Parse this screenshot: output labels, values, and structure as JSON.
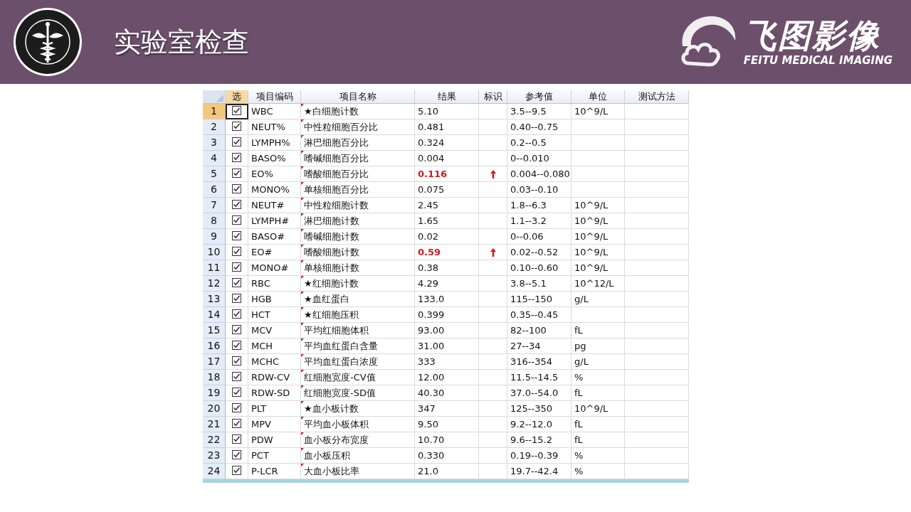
{
  "header": {
    "title": "实验室检查",
    "brand": {
      "name": "飞图影像",
      "tagline": "FEITU MEDICAL IMAGING"
    }
  },
  "table": {
    "columns": [
      "选",
      "项目编码",
      "项目名称",
      "结果",
      "标识",
      "参考值",
      "单位",
      "测试方法"
    ],
    "rows": [
      {
        "number": "1",
        "selected": true,
        "checked": true,
        "code": "WBC",
        "name": "★白细胞计数",
        "result": "5.10",
        "high": false,
        "reference": "3.5--9.5",
        "unit": "10^9/L"
      },
      {
        "number": "2",
        "selected": false,
        "checked": true,
        "code": "NEUT%",
        "name": "中性粒细胞百分比",
        "result": "0.481",
        "high": false,
        "reference": "0.40--0.75"
      },
      {
        "number": "3",
        "selected": false,
        "checked": true,
        "code": "LYMPH%",
        "name": "淋巴细胞百分比",
        "result": "0.324",
        "high": false,
        "reference": "0.2--0.5"
      },
      {
        "number": "4",
        "selected": false,
        "checked": true,
        "code": "BASO%",
        "name": "嗜碱细胞百分比",
        "result": "0.004",
        "high": false,
        "reference": "0--0.010"
      },
      {
        "number": "5",
        "selected": false,
        "checked": true,
        "code": "EO%",
        "name": "嗜酸细胞百分比",
        "result": "0.116",
        "high": true,
        "reference": "0.004--0.080"
      },
      {
        "number": "6",
        "selected": false,
        "checked": true,
        "code": "MONO%",
        "name": "单核细胞百分比",
        "result": "0.075",
        "high": false,
        "reference": "0.03--0.10"
      },
      {
        "number": "7",
        "selected": false,
        "checked": true,
        "code": "NEUT#",
        "name": "中性粒细胞计数",
        "result": "2.45",
        "high": false,
        "reference": "1.8--6.3",
        "unit": "10^9/L"
      },
      {
        "number": "8",
        "selected": false,
        "checked": true,
        "code": "LYMPH#",
        "name": "淋巴细胞计数",
        "result": "1.65",
        "high": false,
        "reference": "1.1--3.2",
        "unit": "10^9/L"
      },
      {
        "number": "9",
        "selected": false,
        "checked": true,
        "code": "BASO#",
        "name": "嗜碱细胞计数",
        "result": "0.02",
        "high": false,
        "reference": "0--0.06",
        "unit": "10^9/L"
      },
      {
        "number": "10",
        "selected": false,
        "checked": true,
        "code": "EO#",
        "name": "嗜酸细胞计数",
        "result": "0.59",
        "high": true,
        "reference": "0.02--0.52",
        "unit": "10^9/L"
      },
      {
        "number": "11",
        "selected": false,
        "checked": true,
        "code": "MONO#",
        "name": "单核细胞计数",
        "result": "0.38",
        "high": false,
        "reference": "0.10--0.60",
        "unit": "10^9/L"
      },
      {
        "number": "12",
        "selected": false,
        "checked": true,
        "code": "RBC",
        "name": "★红细胞计数",
        "result": "4.29",
        "high": false,
        "reference": "3.8--5.1",
        "unit": "10^12/L"
      },
      {
        "number": "13",
        "selected": false,
        "checked": true,
        "code": "HGB",
        "name": "★血红蛋白",
        "result": "133.0",
        "high": false,
        "reference": "115--150",
        "unit": "g/L"
      },
      {
        "number": "14",
        "selected": false,
        "checked": true,
        "code": "HCT",
        "name": "★红细胞压积",
        "result": "0.399",
        "high": false,
        "reference": "0.35--0.45"
      },
      {
        "number": "15",
        "selected": false,
        "checked": true,
        "code": "MCV",
        "name": "平均红细胞体积",
        "result": "93.00",
        "high": false,
        "reference": "82--100",
        "unit": "fL"
      },
      {
        "number": "16",
        "selected": false,
        "checked": true,
        "code": "MCH",
        "name": "平均血红蛋白含量",
        "result": "31.00",
        "high": false,
        "reference": "27--34",
        "unit": "pg"
      },
      {
        "number": "17",
        "selected": false,
        "checked": true,
        "code": "MCHC",
        "name": "平均血红蛋白浓度",
        "result": "333",
        "high": false,
        "reference": "316--354",
        "unit": "g/L"
      },
      {
        "number": "18",
        "selected": false,
        "checked": true,
        "code": "RDW-CV",
        "name": "红细胞宽度-CV值",
        "result": "12.00",
        "high": false,
        "reference": "11.5--14.5",
        "unit": "%"
      },
      {
        "number": "19",
        "selected": false,
        "checked": true,
        "code": "RDW-SD",
        "name": "红细胞宽度-SD值",
        "result": "40.30",
        "high": false,
        "reference": "37.0--54.0",
        "unit": "fL"
      },
      {
        "number": "20",
        "selected": false,
        "checked": true,
        "code": "PLT",
        "name": "★血小板计数",
        "result": "347",
        "high": false,
        "reference": "125--350",
        "unit": "10^9/L"
      },
      {
        "number": "21",
        "selected": false,
        "checked": true,
        "code": "MPV",
        "name": "平均血小板体积",
        "result": "9.50",
        "high": false,
        "reference": "9.2--12.0",
        "unit": "fL"
      },
      {
        "number": "22",
        "selected": false,
        "checked": true,
        "code": "PDW",
        "name": "血小板分布宽度",
        "result": "10.70",
        "high": false,
        "reference": "9.6--15.2",
        "unit": "fL"
      },
      {
        "number": "23",
        "selected": false,
        "checked": true,
        "code": "PCT",
        "name": "血小板压积",
        "result": "0.330",
        "high": false,
        "reference": "0.19--0.39",
        "unit": "%"
      },
      {
        "number": "24",
        "selected": false,
        "checked": true,
        "code": "P-LCR",
        "name": "大血小板比率",
        "result": "21.0",
        "high": false,
        "reference": "19.7--42.4",
        "unit": "%"
      }
    ]
  }
}
